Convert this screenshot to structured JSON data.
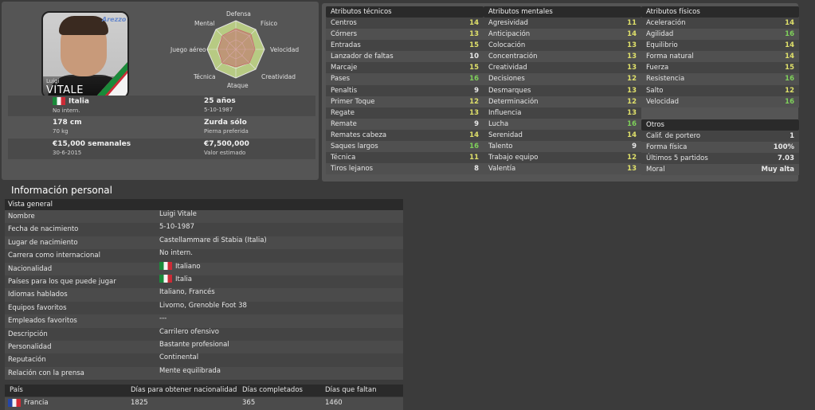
{
  "player": {
    "first_name": "Luigi",
    "last_name": "VITALE",
    "club_logo_text": "Arezzo"
  },
  "radar": {
    "labels": {
      "defensa": "Defensa",
      "fisico": "Físico",
      "velocidad": "Velocidad",
      "creatividad": "Creatividad",
      "ataque": "Ataque",
      "tecnica": "Técnica",
      "juego_aereo": "Juego aéreo",
      "mental": "Mental"
    }
  },
  "summary": {
    "nationality": "Italia",
    "intl_status": "No intern.",
    "age": "25 años",
    "birth_date": "5-10-1987",
    "height": "178 cm",
    "weight": "70 kg",
    "foot": "Zurda sólo",
    "foot_label": "Pierna preferida",
    "wage": "€15,000 semanales",
    "contract_end": "30-6-2015",
    "value": "€7,500,000",
    "value_label": "Valor estimado"
  },
  "tecnicos": {
    "title": "Atributos técnicos",
    "rows": [
      {
        "label": "Centros",
        "value": "14",
        "tone": "y"
      },
      {
        "label": "Córners",
        "value": "13",
        "tone": "y"
      },
      {
        "label": "Entradas",
        "value": "15",
        "tone": "y"
      },
      {
        "label": "Lanzador de faltas",
        "value": "10",
        "tone": "w"
      },
      {
        "label": "Marcaje",
        "value": "15",
        "tone": "y"
      },
      {
        "label": "Pases",
        "value": "16",
        "tone": "g"
      },
      {
        "label": "Penaltis",
        "value": "9",
        "tone": "w"
      },
      {
        "label": "Primer Toque",
        "value": "12",
        "tone": "y"
      },
      {
        "label": "Regate",
        "value": "13",
        "tone": "y"
      },
      {
        "label": "Remate",
        "value": "9",
        "tone": "w"
      },
      {
        "label": "Remates cabeza",
        "value": "14",
        "tone": "y"
      },
      {
        "label": "Saques largos",
        "value": "16",
        "tone": "g"
      },
      {
        "label": "Técnica",
        "value": "11",
        "tone": "y"
      },
      {
        "label": "Tiros lejanos",
        "value": "8",
        "tone": "w"
      }
    ]
  },
  "mentales": {
    "title": "Atributos mentales",
    "rows": [
      {
        "label": "Agresividad",
        "value": "11",
        "tone": "y"
      },
      {
        "label": "Anticipación",
        "value": "14",
        "tone": "y"
      },
      {
        "label": "Colocación",
        "value": "13",
        "tone": "y"
      },
      {
        "label": "Concentración",
        "value": "13",
        "tone": "y"
      },
      {
        "label": "Creatividad",
        "value": "13",
        "tone": "y"
      },
      {
        "label": "Decisiones",
        "value": "12",
        "tone": "y"
      },
      {
        "label": "Desmarques",
        "value": "13",
        "tone": "y"
      },
      {
        "label": "Determinación",
        "value": "12",
        "tone": "y"
      },
      {
        "label": "Influencia",
        "value": "13",
        "tone": "y"
      },
      {
        "label": "Lucha",
        "value": "16",
        "tone": "g"
      },
      {
        "label": "Serenidad",
        "value": "14",
        "tone": "y"
      },
      {
        "label": "Talento",
        "value": "9",
        "tone": "w"
      },
      {
        "label": "Trabajo equipo",
        "value": "12",
        "tone": "y"
      },
      {
        "label": "Valentía",
        "value": "13",
        "tone": "y"
      }
    ]
  },
  "fisicos": {
    "title": "Atributos físicos",
    "rows": [
      {
        "label": "Aceleración",
        "value": "14",
        "tone": "y"
      },
      {
        "label": "Agilidad",
        "value": "16",
        "tone": "g"
      },
      {
        "label": "Equilibrio",
        "value": "14",
        "tone": "y"
      },
      {
        "label": "Forma natural",
        "value": "14",
        "tone": "y"
      },
      {
        "label": "Fuerza",
        "value": "15",
        "tone": "y"
      },
      {
        "label": "Resistencia",
        "value": "16",
        "tone": "g"
      },
      {
        "label": "Salto",
        "value": "12",
        "tone": "y"
      },
      {
        "label": "Velocidad",
        "value": "16",
        "tone": "g"
      }
    ]
  },
  "otros": {
    "title": "Otros",
    "rows": [
      {
        "label": "Calif. de portero",
        "value": "1",
        "tone": "w"
      },
      {
        "label": "Forma física",
        "value": "100%",
        "tone": "w"
      },
      {
        "label": "Últimos 5 partidos",
        "value": "7.03",
        "tone": "w"
      },
      {
        "label": "Moral",
        "value": "Muy alta",
        "tone": "w"
      }
    ]
  },
  "personal": {
    "title": "Información personal",
    "section": "Vista general",
    "rows": [
      {
        "label": "Nombre",
        "value": "Luigi Vitale"
      },
      {
        "label": "Fecha de nacimiento",
        "value": "5-10-1987"
      },
      {
        "label": "Lugar de nacimiento",
        "value": "Castellammare di Stabia (Italia)"
      },
      {
        "label": "Carrera como internacional",
        "value": "No intern."
      },
      {
        "label": "Nacionalidad",
        "value": "Italiano",
        "flag": "it"
      },
      {
        "label": "Países para los que puede jugar",
        "value": "Italia",
        "flag": "it"
      },
      {
        "label": "Idiomas hablados",
        "value": "Italiano, Francés"
      },
      {
        "label": "Equipos favoritos",
        "value": "Livorno, Grenoble Foot 38"
      },
      {
        "label": "Empleados favoritos",
        "value": "---"
      },
      {
        "label": "Descripción",
        "value": "Carrilero ofensivo"
      },
      {
        "label": "Personalidad",
        "value": "Bastante profesional"
      },
      {
        "label": "Reputación",
        "value": "Continental"
      },
      {
        "label": "Relación con la prensa",
        "value": "Mente equilibrada"
      }
    ]
  },
  "nationality_table": {
    "headers": {
      "pais": "País",
      "dias_obtener": "Días para obtener nacionalidad",
      "dias_completados": "Días completados",
      "dias_faltan": "Días que faltan"
    },
    "row": {
      "pais": "Francia",
      "dias_obtener": "1825",
      "dias_completados": "365",
      "dias_faltan": "1460"
    }
  },
  "colors": {
    "green": "#7fd15a",
    "yellow": "#dfe06a",
    "header_bg": "#2a2a2a"
  }
}
